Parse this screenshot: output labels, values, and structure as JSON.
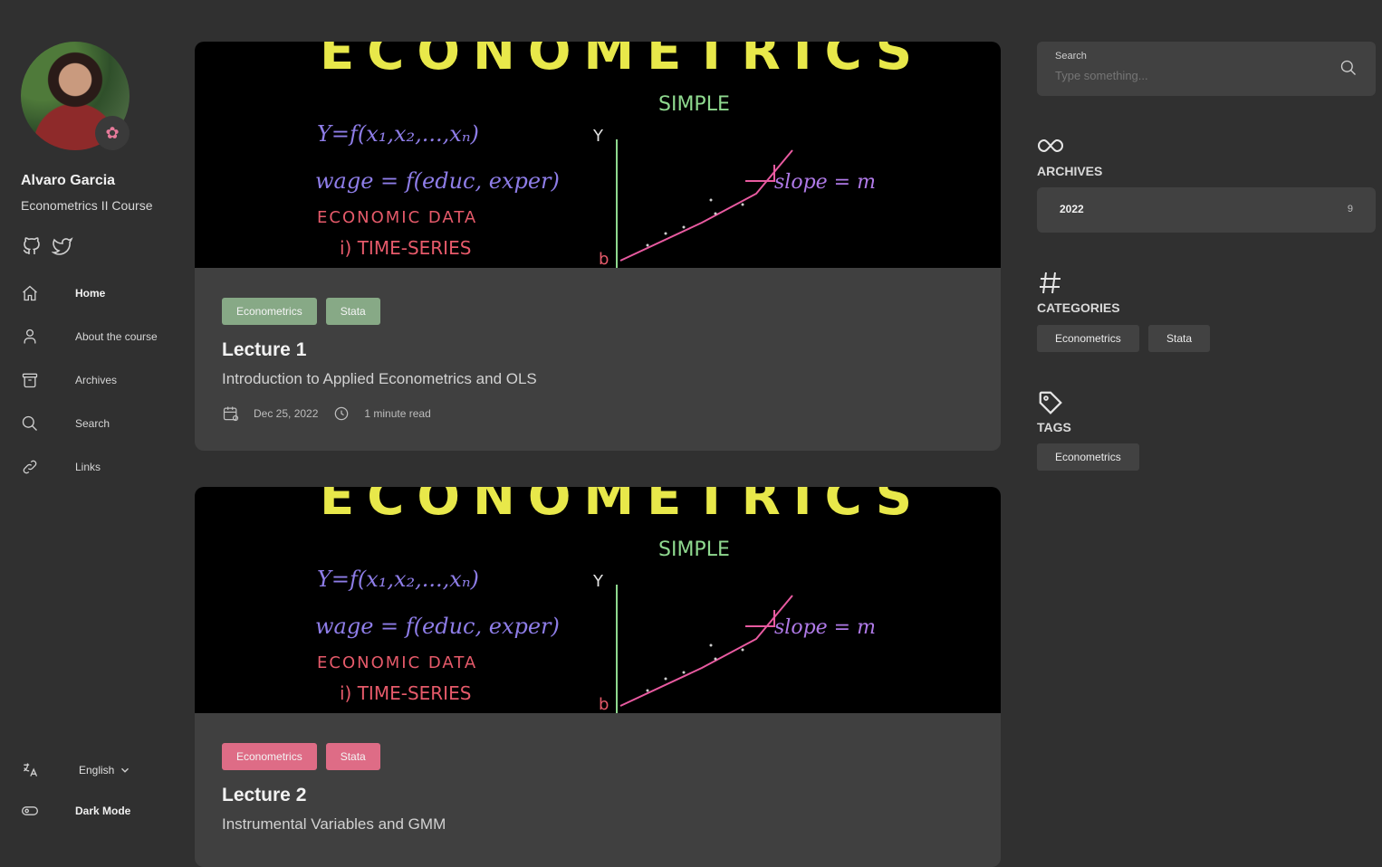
{
  "profile": {
    "name": "Alvaro Garcia",
    "subtitle": "Econometrics II Course",
    "emoji": "brain-icon"
  },
  "nav": {
    "items": [
      {
        "label": "Home",
        "icon": "home-icon",
        "active": true
      },
      {
        "label": "About the course",
        "icon": "user-icon",
        "active": false
      },
      {
        "label": "Archives",
        "icon": "archive-icon",
        "active": false
      },
      {
        "label": "Search",
        "icon": "search-icon",
        "active": false
      },
      {
        "label": "Links",
        "icon": "link-icon",
        "active": false
      }
    ]
  },
  "footer_controls": {
    "language": "English",
    "dark_mode": "Dark Mode"
  },
  "posts": [
    {
      "tags": [
        "Econometrics",
        "Stata"
      ],
      "tag_color": "#87a986",
      "title": "Lecture 1",
      "description": "Introduction to Applied Econometrics and OLS",
      "date": "Dec 25, 2022",
      "read_time": "1 minute read"
    },
    {
      "tags": [
        "Econometrics",
        "Stata"
      ],
      "tag_color": "#de6c86",
      "title": "Lecture 2",
      "description": "Instrumental Variables and GMM"
    }
  ],
  "banner": {
    "top": "ECONOMETRICS",
    "simple": "SIMPLE",
    "eq1": "Y=f(x₁,x₂,...,xₙ)",
    "eq2": "wage = f(educ, exper)",
    "econ": "ECONOMIC DATA",
    "ts": "i) TIME-SERIES",
    "slope": "slope = m",
    "y": "Y",
    "b": "b"
  },
  "search": {
    "label": "Search",
    "placeholder": "Type something..."
  },
  "archives": {
    "title": "ARCHIVES",
    "rows": [
      {
        "year": "2022",
        "count": "9"
      }
    ]
  },
  "categories": {
    "title": "CATEGORIES",
    "items": [
      "Econometrics",
      "Stata"
    ]
  },
  "tags": {
    "title": "TAGS",
    "items": [
      "Econometrics"
    ]
  }
}
